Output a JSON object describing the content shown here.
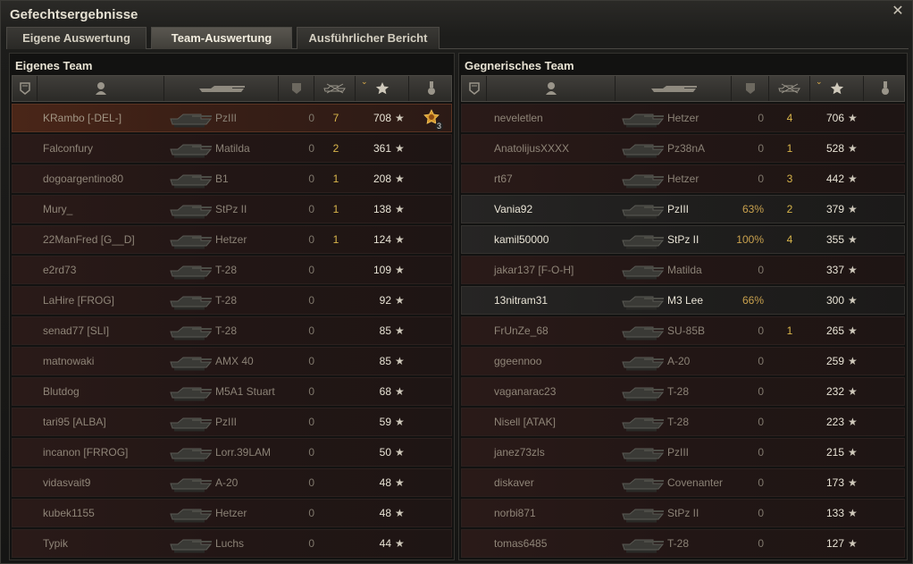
{
  "window": {
    "title": "Gefechtsergebnisse",
    "close_icon": "close-icon"
  },
  "tabs": [
    {
      "label": "Eigene Auswertung",
      "active": false
    },
    {
      "label": "Team-Auswertung",
      "active": true
    },
    {
      "label": "Ausführlicher Bericht",
      "active": false
    }
  ],
  "columns": [
    "squad-icon",
    "player-icon",
    "tank-icon",
    "damage-icon",
    "kills-icon",
    "xp-star-icon",
    "medal-icon"
  ],
  "own_team": {
    "title": "Eigenes Team",
    "rows": [
      {
        "player": "KRambo [-DEL-]",
        "tank": "PzIII",
        "damage": "0",
        "kills": "7",
        "xp": "708",
        "self": true,
        "alive": false,
        "medal": true,
        "medal_count": "3"
      },
      {
        "player": "Falconfury",
        "tank": "Matilda",
        "damage": "0",
        "kills": "2",
        "xp": "361",
        "self": false,
        "alive": false
      },
      {
        "player": "dogoargentino80",
        "tank": "B1",
        "damage": "0",
        "kills": "1",
        "xp": "208",
        "self": false,
        "alive": false
      },
      {
        "player": "Mury_",
        "tank": "StPz II",
        "damage": "0",
        "kills": "1",
        "xp": "138",
        "self": false,
        "alive": false
      },
      {
        "player": "22ManFred [G__D]",
        "tank": "Hetzer",
        "damage": "0",
        "kills": "1",
        "xp": "124",
        "self": false,
        "alive": false
      },
      {
        "player": "e2rd73",
        "tank": "T-28",
        "damage": "0",
        "kills": "",
        "xp": "109",
        "self": false,
        "alive": false
      },
      {
        "player": "LaHire [FROG]",
        "tank": "T-28",
        "damage": "0",
        "kills": "",
        "xp": "92",
        "self": false,
        "alive": false
      },
      {
        "player": "senad77 [SLI]",
        "tank": "T-28",
        "damage": "0",
        "kills": "",
        "xp": "85",
        "self": false,
        "alive": false
      },
      {
        "player": "matnowaki",
        "tank": "AMX 40",
        "damage": "0",
        "kills": "",
        "xp": "85",
        "self": false,
        "alive": false
      },
      {
        "player": "Blutdog",
        "tank": "M5A1 Stuart",
        "damage": "0",
        "kills": "",
        "xp": "68",
        "self": false,
        "alive": false
      },
      {
        "player": "tari95 [ALBA]",
        "tank": "PzIII",
        "damage": "0",
        "kills": "",
        "xp": "59",
        "self": false,
        "alive": false
      },
      {
        "player": "incanon [FRROG]",
        "tank": "Lorr.39LAM",
        "damage": "0",
        "kills": "",
        "xp": "50",
        "self": false,
        "alive": false
      },
      {
        "player": "vidasvait9",
        "tank": "A-20",
        "damage": "0",
        "kills": "",
        "xp": "48",
        "self": false,
        "alive": false
      },
      {
        "player": "kubek1155",
        "tank": "Hetzer",
        "damage": "0",
        "kills": "",
        "xp": "48",
        "self": false,
        "alive": false
      },
      {
        "player": "Typik",
        "tank": "Luchs",
        "damage": "0",
        "kills": "",
        "xp": "44",
        "self": false,
        "alive": false
      }
    ]
  },
  "enemy_team": {
    "title": "Gegnerisches Team",
    "rows": [
      {
        "player": "neveletlen",
        "tank": "Hetzer",
        "damage": "0",
        "kills": "4",
        "xp": "706",
        "alive": false
      },
      {
        "player": "AnatolijusXXXX",
        "tank": "Pz38nA",
        "damage": "0",
        "kills": "1",
        "xp": "528",
        "alive": false
      },
      {
        "player": "rt67",
        "tank": "Hetzer",
        "damage": "0",
        "kills": "3",
        "xp": "442",
        "alive": false
      },
      {
        "player": "Vania92",
        "tank": "PzIII",
        "damage": "63%",
        "kills": "2",
        "xp": "379",
        "alive": true
      },
      {
        "player": "kamil50000",
        "tank": "StPz II",
        "damage": "100%",
        "kills": "4",
        "xp": "355",
        "alive": true
      },
      {
        "player": "jakar137 [F-O-H]",
        "tank": "Matilda",
        "damage": "0",
        "kills": "",
        "xp": "337",
        "alive": false
      },
      {
        "player": "13nitram31",
        "tank": "M3 Lee",
        "damage": "66%",
        "kills": "",
        "xp": "300",
        "alive": true
      },
      {
        "player": "FrUnZe_68",
        "tank": "SU-85B",
        "damage": "0",
        "kills": "1",
        "xp": "265",
        "alive": false
      },
      {
        "player": "ggeennoo",
        "tank": "A-20",
        "damage": "0",
        "kills": "",
        "xp": "259",
        "alive": false
      },
      {
        "player": "vaganarac23",
        "tank": "T-28",
        "damage": "0",
        "kills": "",
        "xp": "232",
        "alive": false
      },
      {
        "player": "Nisell [ATAK]",
        "tank": "T-28",
        "damage": "0",
        "kills": "",
        "xp": "223",
        "alive": false
      },
      {
        "player": "janez73zls",
        "tank": "PzIII",
        "damage": "0",
        "kills": "",
        "xp": "215",
        "alive": false
      },
      {
        "player": "diskaver",
        "tank": "Covenanter",
        "damage": "0",
        "kills": "",
        "xp": "173",
        "alive": false
      },
      {
        "player": "norbi871",
        "tank": "StPz II",
        "damage": "0",
        "kills": "",
        "xp": "133",
        "alive": false
      },
      {
        "player": "tomas6485",
        "tank": "T-28",
        "damage": "0",
        "kills": "",
        "xp": "127",
        "alive": false
      }
    ]
  }
}
